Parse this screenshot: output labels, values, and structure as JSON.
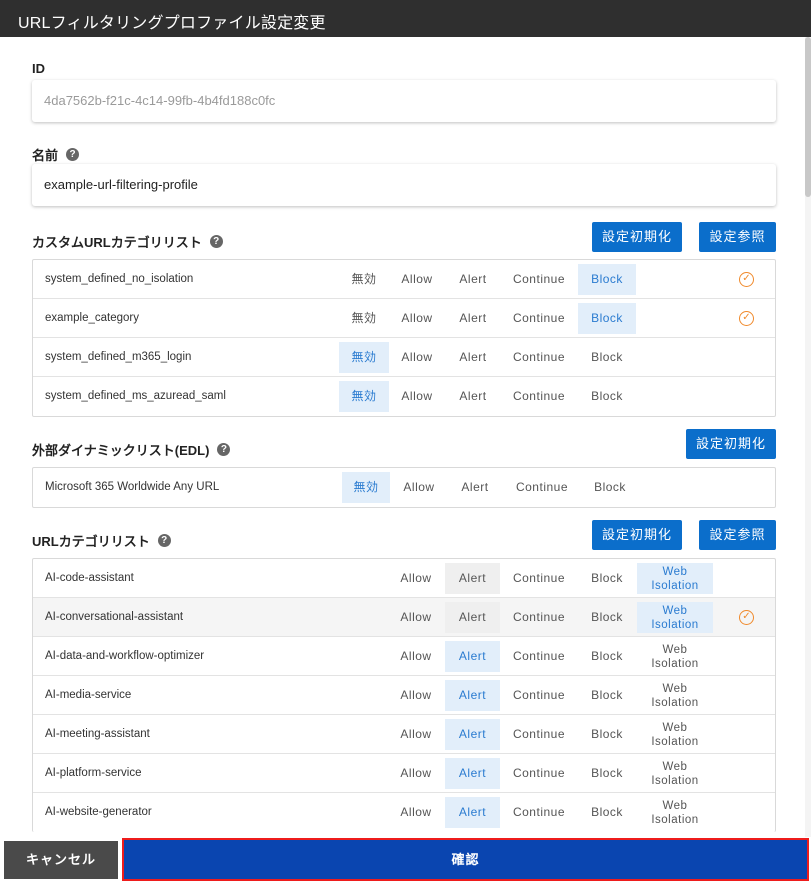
{
  "dialog": {
    "title": "URLフィルタリングプロファイル設定変更"
  },
  "id_field": {
    "label": "ID",
    "value": "4da7562b-f21c-4c14-99fb-4b4fd188c0fc"
  },
  "name_field": {
    "label": "名前",
    "value": "example-url-filtering-profile"
  },
  "buttons": {
    "reset": "設定初期化",
    "browse": "設定参照",
    "cancel": "キャンセル",
    "confirm": "確認"
  },
  "help": "?",
  "check": "✓",
  "custom_url": {
    "label": "カスタムURLカテゴリリスト",
    "rows": [
      {
        "name": "system_defined_no_isolation",
        "options": [
          "無効",
          "Allow",
          "Alert",
          "Continue",
          "Block"
        ],
        "selected": "Block",
        "checked": true
      },
      {
        "name": "example_category",
        "options": [
          "無効",
          "Allow",
          "Alert",
          "Continue",
          "Block"
        ],
        "selected": "Block",
        "checked": true
      },
      {
        "name": "system_defined_m365_login",
        "options": [
          "無効",
          "Allow",
          "Alert",
          "Continue",
          "Block"
        ],
        "selected": "無効",
        "checked": false
      },
      {
        "name": "system_defined_ms_azuread_saml",
        "options": [
          "無効",
          "Allow",
          "Alert",
          "Continue",
          "Block"
        ],
        "selected": "無効",
        "checked": false
      }
    ]
  },
  "edl": {
    "label": "外部ダイナミックリスト(EDL)",
    "rows": [
      {
        "name": "Microsoft 365 Worldwide Any URL",
        "options": [
          "無効",
          "Allow",
          "Alert",
          "Continue",
          "Block"
        ],
        "selected": "無効"
      }
    ]
  },
  "url_categories": {
    "label": "URLカテゴリリスト",
    "rows": [
      {
        "name": "AI-code-assistant",
        "options": [
          "Allow",
          "Alert",
          "Continue",
          "Block",
          "Web Isolation"
        ],
        "web_isolation": [
          "Web",
          "Isolation"
        ],
        "selected": "Web Isolation",
        "default": "Alert",
        "checked": false
      },
      {
        "name": "AI-conversational-assistant",
        "options": [
          "Allow",
          "Alert",
          "Continue",
          "Block",
          "Web Isolation"
        ],
        "web_isolation": [
          "Web",
          "Isolation"
        ],
        "selected": "Web Isolation",
        "default": "Alert",
        "checked": true
      },
      {
        "name": "AI-data-and-workflow-optimizer",
        "options": [
          "Allow",
          "Alert",
          "Continue",
          "Block",
          "Web Isolation"
        ],
        "web_isolation": [
          "Web",
          "Isolation"
        ],
        "selected": "Alert",
        "checked": false
      },
      {
        "name": "AI-media-service",
        "options": [
          "Allow",
          "Alert",
          "Continue",
          "Block",
          "Web Isolation"
        ],
        "web_isolation": [
          "Web",
          "Isolation"
        ],
        "selected": "Alert",
        "checked": false
      },
      {
        "name": "AI-meeting-assistant",
        "options": [
          "Allow",
          "Alert",
          "Continue",
          "Block",
          "Web Isolation"
        ],
        "web_isolation": [
          "Web",
          "Isolation"
        ],
        "selected": "Alert",
        "checked": false
      },
      {
        "name": "AI-platform-service",
        "options": [
          "Allow",
          "Alert",
          "Continue",
          "Block",
          "Web Isolation"
        ],
        "web_isolation": [
          "Web",
          "Isolation"
        ],
        "selected": "Alert",
        "checked": false
      },
      {
        "name": "AI-website-generator",
        "options": [
          "Allow",
          "Alert",
          "Continue",
          "Block",
          "Web Isolation"
        ],
        "web_isolation": [
          "Web",
          "Isolation"
        ],
        "selected": "Alert",
        "checked": false
      }
    ]
  },
  "colors": {
    "accent": "#0b6ecb",
    "confirm": "#0a45b0",
    "highlight_border": "#ee1c1c",
    "check": "#f08a2c",
    "selected_bg": "#e2eefa"
  }
}
